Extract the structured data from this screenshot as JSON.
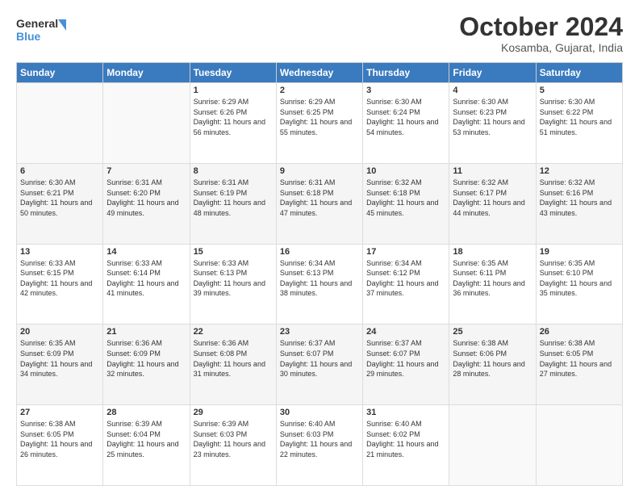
{
  "header": {
    "logo_line1": "General",
    "logo_line2": "Blue",
    "title": "October 2024",
    "subtitle": "Kosamba, Gujarat, India"
  },
  "weekdays": [
    "Sunday",
    "Monday",
    "Tuesday",
    "Wednesday",
    "Thursday",
    "Friday",
    "Saturday"
  ],
  "weeks": [
    [
      {
        "day": "",
        "sunrise": "",
        "sunset": "",
        "daylight": "",
        "empty": true
      },
      {
        "day": "",
        "sunrise": "",
        "sunset": "",
        "daylight": "",
        "empty": true
      },
      {
        "day": "1",
        "sunrise": "Sunrise: 6:29 AM",
        "sunset": "Sunset: 6:26 PM",
        "daylight": "Daylight: 11 hours and 56 minutes.",
        "empty": false
      },
      {
        "day": "2",
        "sunrise": "Sunrise: 6:29 AM",
        "sunset": "Sunset: 6:25 PM",
        "daylight": "Daylight: 11 hours and 55 minutes.",
        "empty": false
      },
      {
        "day": "3",
        "sunrise": "Sunrise: 6:30 AM",
        "sunset": "Sunset: 6:24 PM",
        "daylight": "Daylight: 11 hours and 54 minutes.",
        "empty": false
      },
      {
        "day": "4",
        "sunrise": "Sunrise: 6:30 AM",
        "sunset": "Sunset: 6:23 PM",
        "daylight": "Daylight: 11 hours and 53 minutes.",
        "empty": false
      },
      {
        "day": "5",
        "sunrise": "Sunrise: 6:30 AM",
        "sunset": "Sunset: 6:22 PM",
        "daylight": "Daylight: 11 hours and 51 minutes.",
        "empty": false
      }
    ],
    [
      {
        "day": "6",
        "sunrise": "Sunrise: 6:30 AM",
        "sunset": "Sunset: 6:21 PM",
        "daylight": "Daylight: 11 hours and 50 minutes.",
        "empty": false
      },
      {
        "day": "7",
        "sunrise": "Sunrise: 6:31 AM",
        "sunset": "Sunset: 6:20 PM",
        "daylight": "Daylight: 11 hours and 49 minutes.",
        "empty": false
      },
      {
        "day": "8",
        "sunrise": "Sunrise: 6:31 AM",
        "sunset": "Sunset: 6:19 PM",
        "daylight": "Daylight: 11 hours and 48 minutes.",
        "empty": false
      },
      {
        "day": "9",
        "sunrise": "Sunrise: 6:31 AM",
        "sunset": "Sunset: 6:18 PM",
        "daylight": "Daylight: 11 hours and 47 minutes.",
        "empty": false
      },
      {
        "day": "10",
        "sunrise": "Sunrise: 6:32 AM",
        "sunset": "Sunset: 6:18 PM",
        "daylight": "Daylight: 11 hours and 45 minutes.",
        "empty": false
      },
      {
        "day": "11",
        "sunrise": "Sunrise: 6:32 AM",
        "sunset": "Sunset: 6:17 PM",
        "daylight": "Daylight: 11 hours and 44 minutes.",
        "empty": false
      },
      {
        "day": "12",
        "sunrise": "Sunrise: 6:32 AM",
        "sunset": "Sunset: 6:16 PM",
        "daylight": "Daylight: 11 hours and 43 minutes.",
        "empty": false
      }
    ],
    [
      {
        "day": "13",
        "sunrise": "Sunrise: 6:33 AM",
        "sunset": "Sunset: 6:15 PM",
        "daylight": "Daylight: 11 hours and 42 minutes.",
        "empty": false
      },
      {
        "day": "14",
        "sunrise": "Sunrise: 6:33 AM",
        "sunset": "Sunset: 6:14 PM",
        "daylight": "Daylight: 11 hours and 41 minutes.",
        "empty": false
      },
      {
        "day": "15",
        "sunrise": "Sunrise: 6:33 AM",
        "sunset": "Sunset: 6:13 PM",
        "daylight": "Daylight: 11 hours and 39 minutes.",
        "empty": false
      },
      {
        "day": "16",
        "sunrise": "Sunrise: 6:34 AM",
        "sunset": "Sunset: 6:13 PM",
        "daylight": "Daylight: 11 hours and 38 minutes.",
        "empty": false
      },
      {
        "day": "17",
        "sunrise": "Sunrise: 6:34 AM",
        "sunset": "Sunset: 6:12 PM",
        "daylight": "Daylight: 11 hours and 37 minutes.",
        "empty": false
      },
      {
        "day": "18",
        "sunrise": "Sunrise: 6:35 AM",
        "sunset": "Sunset: 6:11 PM",
        "daylight": "Daylight: 11 hours and 36 minutes.",
        "empty": false
      },
      {
        "day": "19",
        "sunrise": "Sunrise: 6:35 AM",
        "sunset": "Sunset: 6:10 PM",
        "daylight": "Daylight: 11 hours and 35 minutes.",
        "empty": false
      }
    ],
    [
      {
        "day": "20",
        "sunrise": "Sunrise: 6:35 AM",
        "sunset": "Sunset: 6:09 PM",
        "daylight": "Daylight: 11 hours and 34 minutes.",
        "empty": false
      },
      {
        "day": "21",
        "sunrise": "Sunrise: 6:36 AM",
        "sunset": "Sunset: 6:09 PM",
        "daylight": "Daylight: 11 hours and 32 minutes.",
        "empty": false
      },
      {
        "day": "22",
        "sunrise": "Sunrise: 6:36 AM",
        "sunset": "Sunset: 6:08 PM",
        "daylight": "Daylight: 11 hours and 31 minutes.",
        "empty": false
      },
      {
        "day": "23",
        "sunrise": "Sunrise: 6:37 AM",
        "sunset": "Sunset: 6:07 PM",
        "daylight": "Daylight: 11 hours and 30 minutes.",
        "empty": false
      },
      {
        "day": "24",
        "sunrise": "Sunrise: 6:37 AM",
        "sunset": "Sunset: 6:07 PM",
        "daylight": "Daylight: 11 hours and 29 minutes.",
        "empty": false
      },
      {
        "day": "25",
        "sunrise": "Sunrise: 6:38 AM",
        "sunset": "Sunset: 6:06 PM",
        "daylight": "Daylight: 11 hours and 28 minutes.",
        "empty": false
      },
      {
        "day": "26",
        "sunrise": "Sunrise: 6:38 AM",
        "sunset": "Sunset: 6:05 PM",
        "daylight": "Daylight: 11 hours and 27 minutes.",
        "empty": false
      }
    ],
    [
      {
        "day": "27",
        "sunrise": "Sunrise: 6:38 AM",
        "sunset": "Sunset: 6:05 PM",
        "daylight": "Daylight: 11 hours and 26 minutes.",
        "empty": false
      },
      {
        "day": "28",
        "sunrise": "Sunrise: 6:39 AM",
        "sunset": "Sunset: 6:04 PM",
        "daylight": "Daylight: 11 hours and 25 minutes.",
        "empty": false
      },
      {
        "day": "29",
        "sunrise": "Sunrise: 6:39 AM",
        "sunset": "Sunset: 6:03 PM",
        "daylight": "Daylight: 11 hours and 23 minutes.",
        "empty": false
      },
      {
        "day": "30",
        "sunrise": "Sunrise: 6:40 AM",
        "sunset": "Sunset: 6:03 PM",
        "daylight": "Daylight: 11 hours and 22 minutes.",
        "empty": false
      },
      {
        "day": "31",
        "sunrise": "Sunrise: 6:40 AM",
        "sunset": "Sunset: 6:02 PM",
        "daylight": "Daylight: 11 hours and 21 minutes.",
        "empty": false
      },
      {
        "day": "",
        "sunrise": "",
        "sunset": "",
        "daylight": "",
        "empty": true
      },
      {
        "day": "",
        "sunrise": "",
        "sunset": "",
        "daylight": "",
        "empty": true
      }
    ]
  ]
}
